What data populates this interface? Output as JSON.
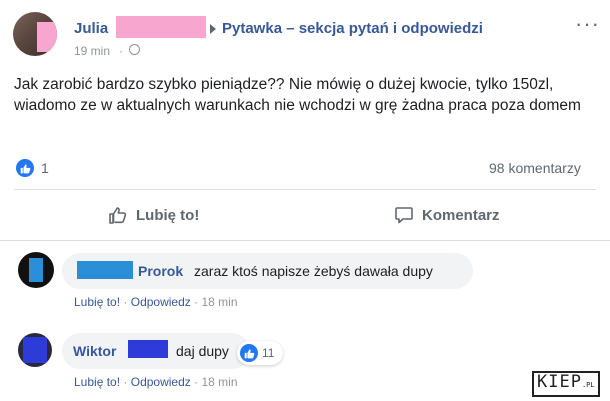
{
  "post": {
    "author": "Julia",
    "group": "Pytawka – sekcja pytań i odpowiedzi",
    "time": "19 min",
    "text": "Jak zarobić bardzo szybko pieniądze?? Nie mówię o dużej kwocie, tylko 150zl, wiadomo ze w aktualnych warunkach nie wchodzi w grę żadna praca poza domem",
    "reactions_count": "1",
    "comments_count": "98 komentarzy",
    "actions": {
      "like": "Lubię to!",
      "comment": "Komentarz"
    }
  },
  "comments": [
    {
      "author": "Prorok",
      "text": "zaraz ktoś napisze żebyś dawała dupy",
      "like": "Lubię to!",
      "reply": "Odpowiedz",
      "time": "18 min"
    },
    {
      "author": "Wiktor",
      "text": "daj dupy",
      "reactions": "11",
      "like": "Lubię to!",
      "reply": "Odpowiedz",
      "time": "18 min"
    }
  ],
  "watermark": {
    "main": "KIEP",
    "suffix": ".PL"
  },
  "colors": {
    "accent": "#385898",
    "like_blue": "#2078f4",
    "censor_pink": "#f7a7cf",
    "censor_blue": "#2a8fd6",
    "censor_darkblue": "#2d3bd8"
  },
  "icons": [
    "more-icon",
    "globe-icon",
    "like-reaction-icon",
    "thumbs-up-icon",
    "comment-icon"
  ]
}
